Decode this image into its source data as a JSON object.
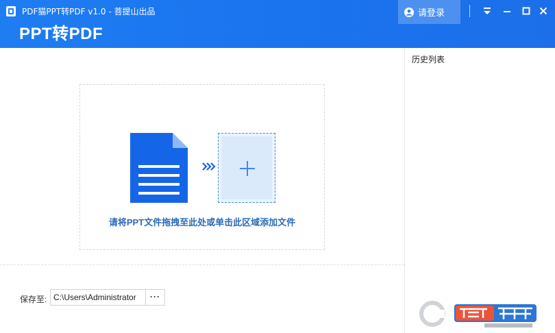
{
  "window": {
    "title": "PDF猫PPT转PDF v1.0 - 菩提山出品",
    "app_heading": "PPT转PDF",
    "login_label": "请登录"
  },
  "main": {
    "drop_hint": "请将PPT文件拖拽至此处或单击此区域添加文件",
    "save_label": "保存至:",
    "save_path": "C:\\Users\\Administrator",
    "browse_label": "···"
  },
  "sidebar": {
    "title": "历史列表"
  },
  "colors": {
    "header": "#1f7df2",
    "doc_icon": "#1565e8",
    "hint_text": "#2b6bb8"
  },
  "icons": [
    "app-logo-icon",
    "user-icon",
    "dropdown-icon",
    "minimize-icon",
    "maximize-icon",
    "close-icon",
    "document-icon",
    "arrows-right-icon",
    "plus-icon"
  ]
}
